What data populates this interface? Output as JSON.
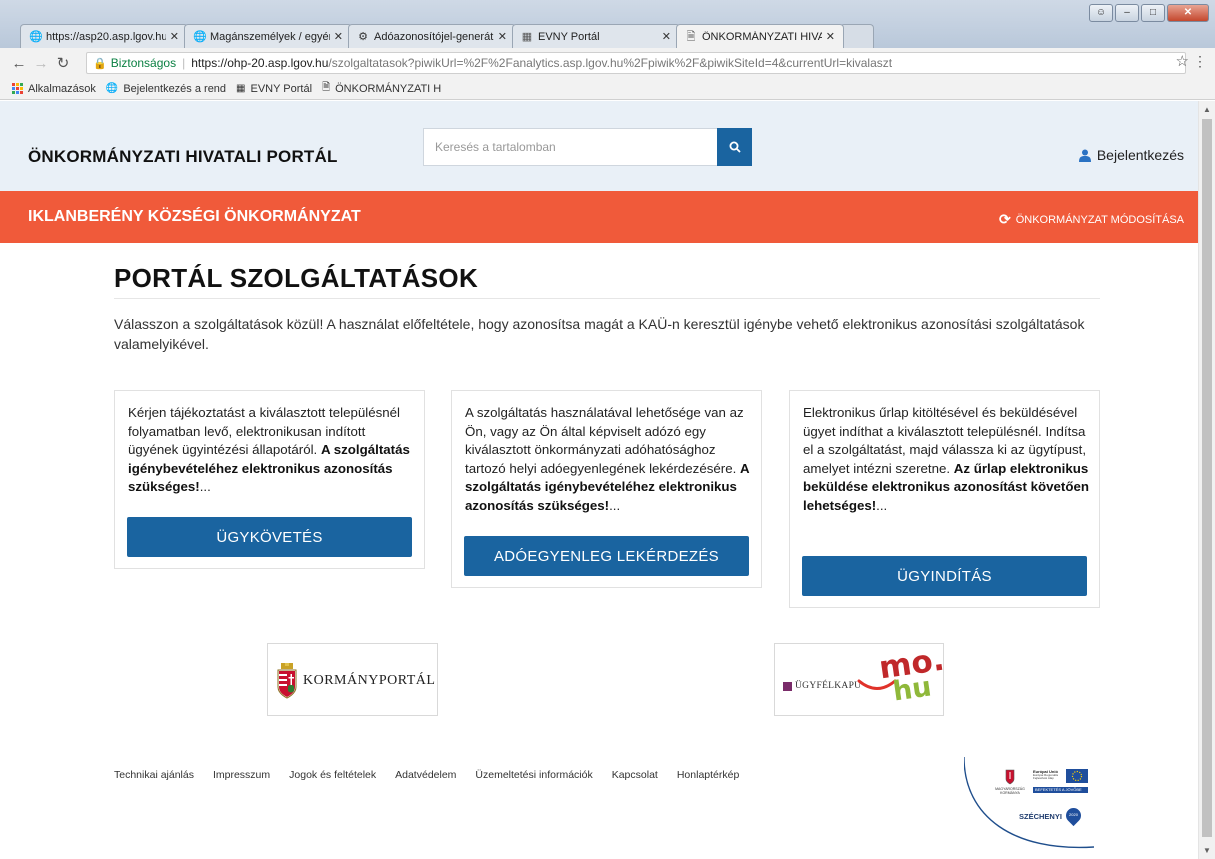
{
  "browser": {
    "tabs": [
      {
        "title": "https://asp20.asp.lgov.hu",
        "icon": "globe-icon",
        "active": false
      },
      {
        "title": "Magánszemélyek / egyéni",
        "icon": "globe-icon",
        "active": false
      },
      {
        "title": "Adóazonosítójel-generát",
        "icon": "gear-icon",
        "active": false
      },
      {
        "title": "EVNY Portál",
        "icon": "id-card-icon",
        "active": false
      },
      {
        "title": "ÖNKORMÁNYZATI HIVA",
        "icon": "page-icon",
        "active": true
      }
    ],
    "secure_label": "Biztonságos",
    "url_host": "https://ohp-20.asp.lgov.hu",
    "url_path": "/szolgaltatasok?piwikUrl=%2F%2Fanalytics.asp.lgov.hu%2Fpiwik%2F&piwikSiteId=4&currentUrl=kivalaszt",
    "bookmarks": [
      {
        "label": "Alkalmazások",
        "icon": "apps-icon"
      },
      {
        "label": "Bejelentkezés a rend",
        "icon": "globe-icon"
      },
      {
        "label": "EVNY Portál",
        "icon": "id-card-icon"
      },
      {
        "label": "ÖNKORMÁNYZATI H",
        "icon": "page-icon"
      }
    ]
  },
  "header": {
    "site_title": "ÖNKORMÁNYZATI HIVATALI PORTÁL",
    "search_placeholder": "Keresés a tartalomban",
    "login_label": "Bejelentkezés"
  },
  "org_bar": {
    "name": "IKLANBERÉNY KÖZSÉGI ÖNKORMÁNYZAT",
    "change_label": "ÖNKORMÁNYZAT MÓDOSÍTÁSA"
  },
  "main": {
    "title": "PORTÁL SZOLGÁLTATÁSOK",
    "intro": "Válasszon a szolgáltatások közül! A használat előfeltétele, hogy azonosítsa magát a KAÜ-n keresztül igénybe vehető elektronikus azonosítási szolgáltatások valamelyikével."
  },
  "cards": [
    {
      "text": "Kérjen tájékoztatást a kiválasztott településnél folyamatban levő, elektronikusan indított ügyének ügyintézési állapotáról.",
      "bold": "A szolgáltatás igénybevételéhez elektronikus azonosítás szükséges!",
      "suffix": "...",
      "button": "ÜGYKÖVETÉS"
    },
    {
      "text": "A szolgáltatás használatával lehetősége van az Ön, vagy az Ön által képviselt adózó egy kiválasztott önkormányzati adóhatósághoz tartozó helyi adóegyenlegének lekérdezésére.",
      "bold": "A szolgáltatás igénybevételéhez elektronikus azonosítás szükséges!",
      "suffix": "...",
      "button": "ADÓEGYENLEG LEKÉRDEZÉS"
    },
    {
      "text": "Elektronikus űrlap kitöltésével és beküldésével ügyet indíthat a kiválasztott településnél. Indítsa el a szolgáltatást, majd válassza ki az ügytípust, amelyet intézni szeretne.",
      "bold": "Az űrlap elektronikus beküldése elektronikus azonosítást követően lehetséges!",
      "suffix": "...",
      "button": "ÜGYINDÍTÁS"
    }
  ],
  "logos": {
    "kormanyportal": "KORMÁNYPORTÁL",
    "ugyfelkapu": "ÜGYFÉLKAPU",
    "ugyfelkapu_mo": "mo.",
    "ugyfelkapu_hu": "hu"
  },
  "footer": {
    "links": [
      "Technikai ajánlás",
      "Impresszum",
      "Jogok és feltételek",
      "Adatvédelem",
      "Üzemeltetési információk",
      "Kapcsolat",
      "Honlaptérkép"
    ],
    "eu_line1": "Európai Unió",
    "eu_line2": "Európai Regionális Fejlesztési Alap",
    "eu_banner": "BEFEKTETÉS A JÖVŐBE",
    "hu_gov": "MAGYARORSZÁG KORMÁNYA",
    "szechenyi": "SZÉCHENYI",
    "szechenyi_year": "2020"
  },
  "colors": {
    "accent_blue": "#1a64a0",
    "orange": "#f05a3a",
    "header_bg": "#e9f0f7"
  }
}
